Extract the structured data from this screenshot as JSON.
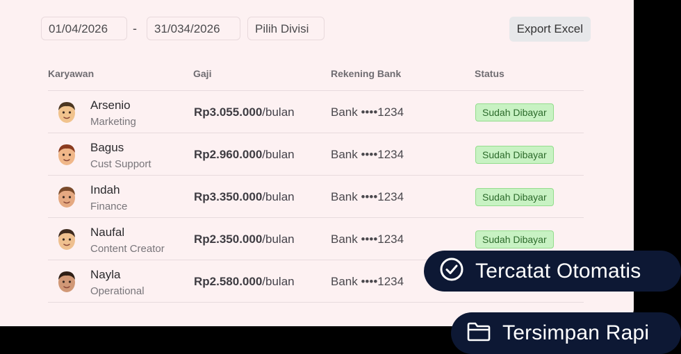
{
  "filters": {
    "date_start": "01/04/2026",
    "separator": "-",
    "date_end": "31/034/2026",
    "division": "Pilih Divisi",
    "export_label": "Export Excel"
  },
  "table": {
    "headers": [
      "Karyawan",
      "Gaji",
      "Rekening Bank",
      "Status"
    ],
    "rows": [
      {
        "name": "Arsenio",
        "role": "Marketing",
        "salary": "Rp3.055.000",
        "period": "/bulan",
        "bank": "Bank ••••1234",
        "status": "Sudah Dibayar"
      },
      {
        "name": "Bagus",
        "role": "Cust Support",
        "salary": "Rp2.960.000",
        "period": "/bulan",
        "bank": "Bank ••••1234",
        "status": "Sudah Dibayar"
      },
      {
        "name": "Indah",
        "role": "Finance",
        "salary": "Rp3.350.000",
        "period": "/bulan",
        "bank": "Bank ••••1234",
        "status": "Sudah Dibayar"
      },
      {
        "name": "Naufal",
        "role": "Content Creator",
        "salary": "Rp2.350.000",
        "period": "/bulan",
        "bank": "Bank ••••1234",
        "status": "Sudah Dibayar"
      },
      {
        "name": "Nayla",
        "role": "Operational",
        "salary": "Rp2.580.000",
        "period": "/bulan",
        "bank": "Bank ••••1234",
        "status": ""
      }
    ]
  },
  "badges": {
    "auto_recorded": "Tercatat Otomatis",
    "neatly_saved": "Tersimpan Rapi"
  },
  "icons": {
    "check": "check-circle-icon",
    "folder": "folder-icon",
    "avatar": "memoji-avatar-icon"
  },
  "colors": {
    "card_bg": "#fdf1f2",
    "pill_bg": "#0d1834",
    "status_bg": "#c8f2c3",
    "status_text": "#2b6a2a"
  }
}
